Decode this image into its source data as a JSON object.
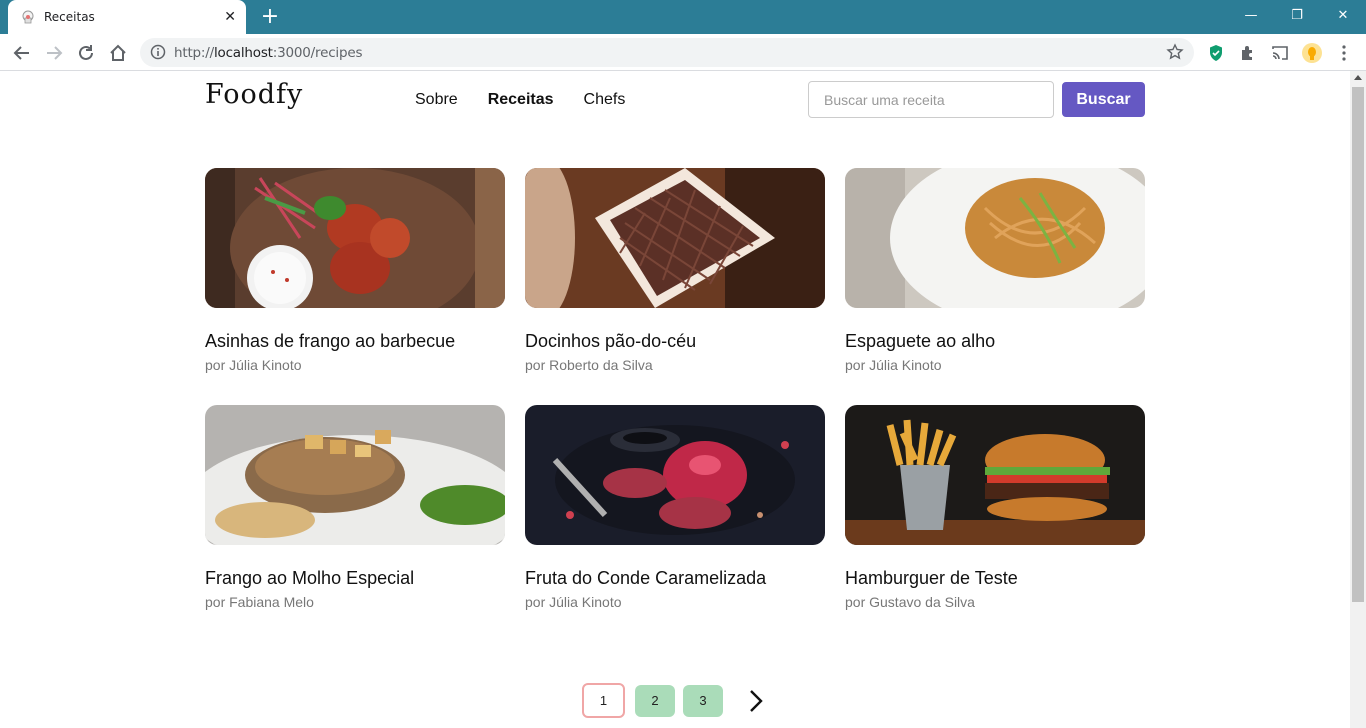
{
  "browser": {
    "tab_title": "Receitas",
    "tab_close": "✕",
    "new_tab": "+",
    "url_prefix": "http://",
    "url_host": "localhost",
    "url_rest": ":3000/recipes",
    "window_controls": {
      "minimize": "—",
      "restore": "❐",
      "close": "✕"
    }
  },
  "header": {
    "logo": "Foodfy",
    "nav": [
      {
        "label": "Sobre",
        "active": false
      },
      {
        "label": "Receitas",
        "active": true
      },
      {
        "label": "Chefs",
        "active": false
      }
    ],
    "search_placeholder": "Buscar uma receita",
    "search_button": "Buscar"
  },
  "recipes": [
    {
      "title": "Asinhas de frango ao barbecue",
      "author": "por Júlia Kinoto",
      "image": "barbecue-wings-photo"
    },
    {
      "title": "Docinhos pão-do-céu",
      "author": "por Roberto da Silva",
      "image": "chocolate-box-photo"
    },
    {
      "title": "Espaguete ao alho",
      "author": "por Júlia Kinoto",
      "image": "spaghetti-plate-photo"
    },
    {
      "title": "Frango ao Molho Especial",
      "author": "por Fabiana Melo",
      "image": "chicken-sauce-photo"
    },
    {
      "title": "Fruta do Conde Caramelizada",
      "author": "por Júlia Kinoto",
      "image": "pomegranate-photo"
    },
    {
      "title": "Hamburguer de Teste",
      "author": "por Gustavo da Silva",
      "image": "burger-fries-photo"
    }
  ],
  "pagination": {
    "pages": [
      "1",
      "2",
      "3"
    ],
    "current": "1",
    "next_icon": "chevron-right-icon"
  },
  "colors": {
    "brand": "#6558c3",
    "tabstrip": "#2c7d96",
    "page_inactive": "#aadcb9",
    "page_current_border": "#f0a6a6"
  }
}
